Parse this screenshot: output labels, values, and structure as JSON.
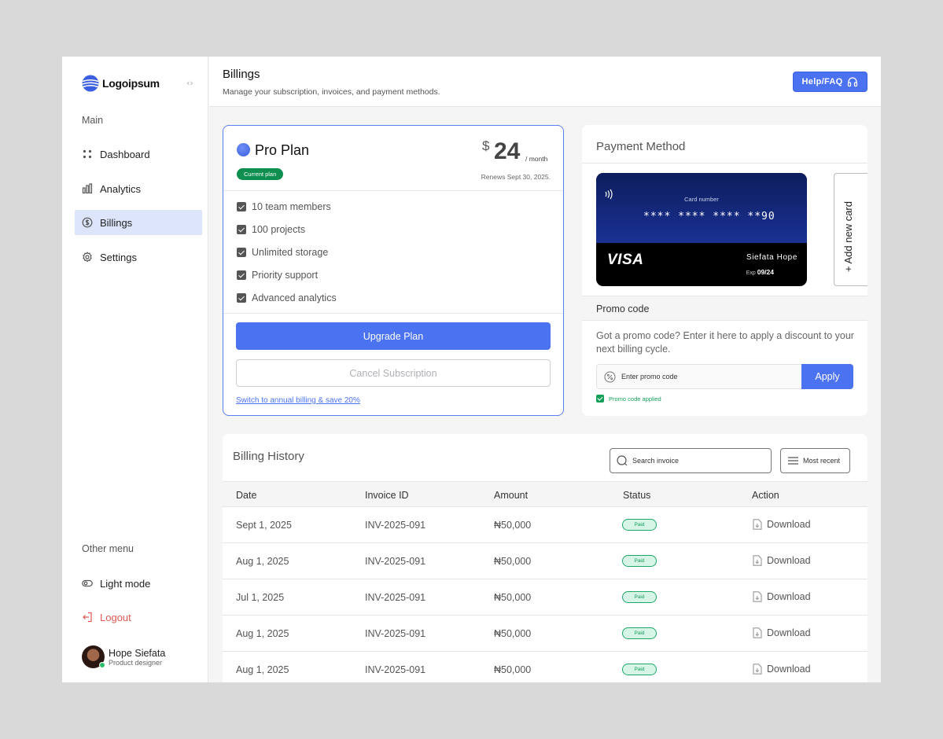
{
  "sidebar": {
    "logo_text": "Logoipsum",
    "main_label": "Main",
    "items": [
      {
        "label": "Dashboard",
        "icon": "grid-dots-icon"
      },
      {
        "label": "Analytics",
        "icon": "bar-chart-icon"
      },
      {
        "label": "Billings",
        "icon": "billing-icon",
        "active": true
      },
      {
        "label": "Settings",
        "icon": "gear-icon"
      }
    ],
    "other_label": "Other menu",
    "light_mode_label": "Light mode",
    "logout_label": "Logout",
    "user": {
      "name": "Hope Siefata",
      "role": "Product designer"
    }
  },
  "header": {
    "title": "Billings",
    "subtitle": "Manage your subscription, invoices, and payment methods.",
    "help_label": "Help/FAQ"
  },
  "plan": {
    "name": "Pro Plan",
    "badge": "Current plan",
    "currency": "$",
    "price": "24",
    "period": "/ month",
    "renews": "Renews Sept 30, 2025.",
    "features": [
      "10 team members",
      "100 projects",
      "Unlimited storage",
      "Priority support",
      "Advanced analytics"
    ],
    "upgrade_label": "Upgrade Plan",
    "cancel_label": "Cancel Subscription",
    "annual_link": "Switch to annual billing & save 20%"
  },
  "payment": {
    "title": "Payment Method",
    "card": {
      "number_label": "Card number",
      "number": "**** **** **** **90",
      "brand": "VISA",
      "holder": "Siefata Hope",
      "exp_label": "Exp",
      "exp": "09/24"
    },
    "add_card_label": "+ Add new card",
    "promo_title": "Promo code",
    "promo_desc": "Got a promo code? Enter it here to apply a discount to your next billing cycle.",
    "promo_placeholder": "Enter promo code",
    "apply_label": "Apply",
    "promo_applied": "Promo code applied"
  },
  "history": {
    "title": "Billing History",
    "search_placeholder": "Search invoice",
    "sort_label": "Most recent",
    "columns": [
      "Date",
      "Invoice ID",
      "Amount",
      "Status",
      "Action"
    ],
    "rows": [
      {
        "date": "Sept 1, 2025",
        "invoice": "INV-2025-091",
        "amount": "₦50,000",
        "status": "Paid",
        "action": "Download"
      },
      {
        "date": "Aug 1, 2025",
        "invoice": "INV-2025-091",
        "amount": "₦50,000",
        "status": "Paid",
        "action": "Download"
      },
      {
        "date": "Jul 1, 2025",
        "invoice": "INV-2025-091",
        "amount": "₦50,000",
        "status": "Paid",
        "action": "Download"
      },
      {
        "date": "Aug 1, 2025",
        "invoice": "INV-2025-091",
        "amount": "₦50,000",
        "status": "Paid",
        "action": "Download"
      },
      {
        "date": "Aug 1, 2025",
        "invoice": "INV-2025-091",
        "amount": "₦50,000",
        "status": "Paid",
        "action": "Download"
      }
    ]
  },
  "colors": {
    "accent": "#4b72f0",
    "success": "#14a05a",
    "danger": "#e05a54",
    "active_bg": "#dde5fa"
  }
}
